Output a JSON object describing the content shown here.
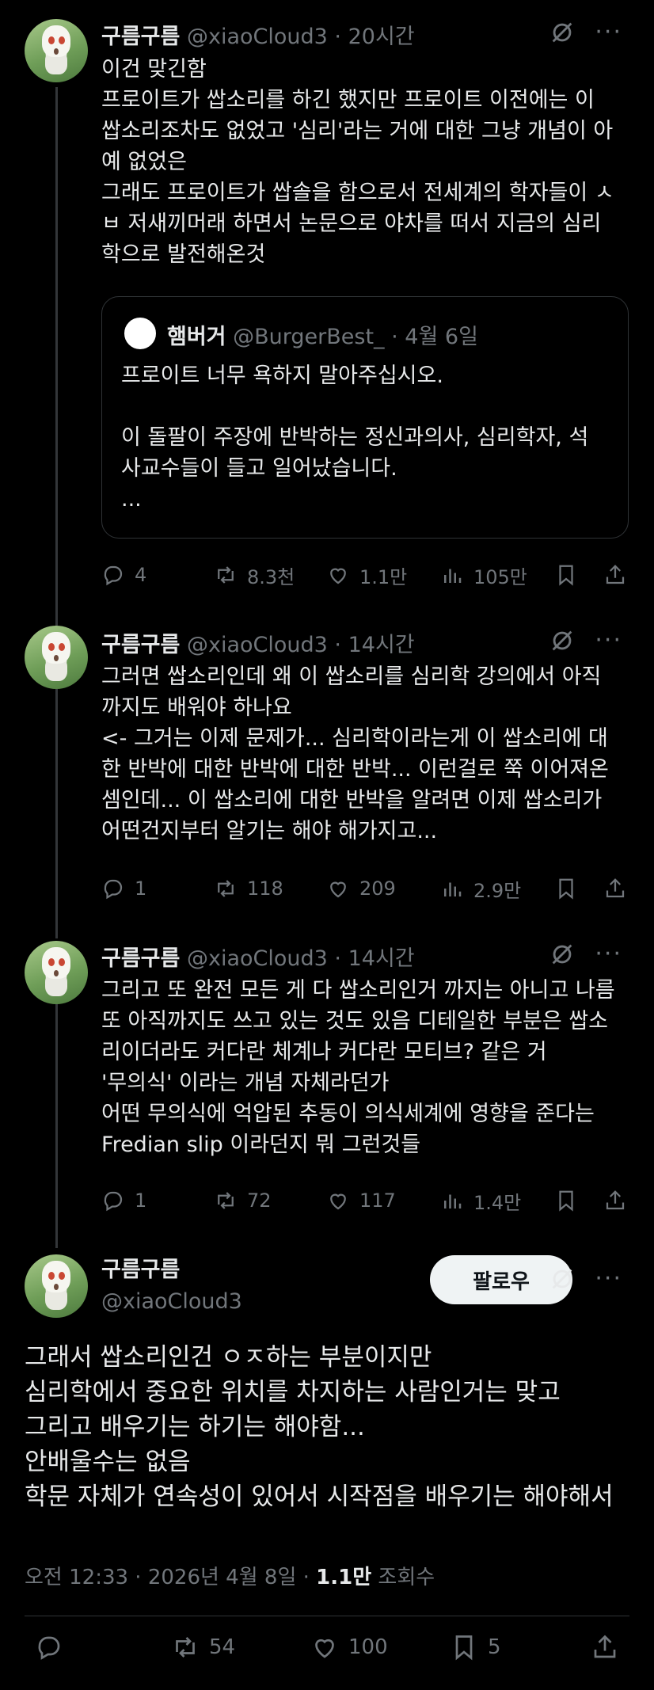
{
  "tweets": [
    {
      "name": "구름구름",
      "handle": "@xiaoCloud3",
      "time": "· 20시간",
      "lines": [
        "이건 맞긴함",
        "프로이트가 쌉소리를 하긴 했지만 프로이트 이전에는 이",
        "쌉소리조차도 없었고 '심리'라는 거에 대한 그냥 개념이 아",
        "예 없었은",
        "그래도 프로이트가 쌉솔을 함으로서 전세계의 학자들이 ㅅ",
        "ㅂ 저새끼머래  하면서 논문으로 야차를 떠서 지금의 심리",
        "학으로 발전해온것"
      ],
      "quote": {
        "name": "햄버거",
        "handle": "@BurgerBest_",
        "time": "· 4월 6일",
        "lines": [
          "프로이트 너무 욕하지 말아주십시오.",
          "",
          "이 돌팔이 주장에 반박하는 정신과의사, 심리학자, 석",
          "사교수들이 들고 일어났습니다.",
          "..."
        ]
      },
      "stats": {
        "replies": "4",
        "reposts": "8.3천",
        "likes": "1.1만",
        "views": "105만"
      }
    },
    {
      "name": "구름구름",
      "handle": "@xiaoCloud3",
      "time": "· 14시간",
      "lines": [
        "그러면 쌉소리인데 왜 이 쌉소리를 심리학 강의에서 아직",
        "까지도 배워야 하나요",
        "<- 그거는 이제 문제가... 심리학이라는게 이 쌉소리에 대",
        "한 반박에 대한 반박에 대한 반박... 이런걸로 쭉 이어져온",
        "셈인데... 이 쌉소리에 대한 반박을 알려면 이제 쌉소리가",
        "어떤건지부터 알기는 해야 해가지고..."
      ],
      "stats": {
        "replies": "1",
        "reposts": "118",
        "likes": "209",
        "views": "2.9만"
      }
    },
    {
      "name": "구름구름",
      "handle": "@xiaoCloud3",
      "time": "· 14시간",
      "lines": [
        "그리고 또 완전 모든 게 다 쌉소리인거 까지는 아니고 나름",
        "또 아직까지도 쓰고 있는 것도 있음 디테일한 부분은 쌉소",
        "리이더라도 커다란 체계나 커다란 모티브? 같은 거",
        "'무의식' 이라는 개념 자체라던가",
        "어떤 무의식에 억압된 추동이 의식세계에 영향을 준다는",
        "Fredian slip 이라던지 뭐 그런것들"
      ],
      "stats": {
        "replies": "1",
        "reposts": "72",
        "likes": "117",
        "views": "1.4만"
      }
    }
  ],
  "main": {
    "name": "구름구름",
    "handle": "@xiaoCloud3",
    "follow_label": "팔로우",
    "lines": [
      "그래서 쌉소리인건 ㅇㅈ하는 부분이지만",
      "심리학에서 중요한 위치를 차지하는 사람인거는 맞고",
      "그리고 배우기는 하기는 해야함...",
      "안배울수는 없음",
      "학문 자체가 연속성이 있어서 시작점을 배우기는 해야해서"
    ],
    "timestamp": "오전 12:33 · 2026년 4월 8일 · ",
    "view_count": "1.1만",
    "view_label": " 조회수",
    "stats": {
      "reposts": "54",
      "likes": "100",
      "bookmarks": "5"
    }
  }
}
